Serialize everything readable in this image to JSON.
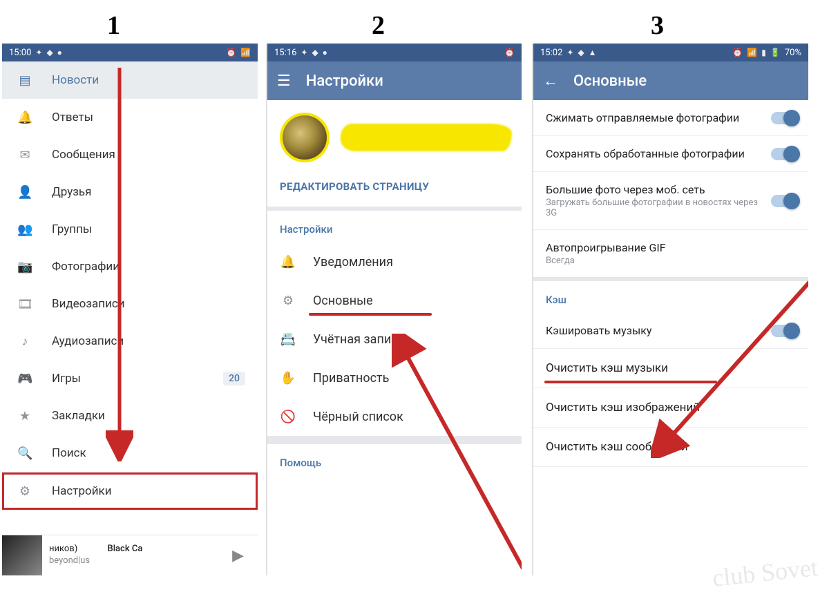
{
  "steps": {
    "s1": "1",
    "s2": "2",
    "s3": "3"
  },
  "shot1": {
    "time": "15:00",
    "menu": {
      "news": "Новости",
      "replies": "Ответы",
      "messages": "Сообщения",
      "friends": "Друзья",
      "groups": "Группы",
      "photos": "Фотографии",
      "videos": "Видеозаписи",
      "audio": "Аудиозаписи",
      "games": "Игры",
      "games_badge": "20",
      "bookmarks": "Закладки",
      "search": "Поиск",
      "settings": "Настройки"
    },
    "player": {
      "title_left": "ников)",
      "title_right": "Black Ca",
      "subtitle": "beyond|us"
    }
  },
  "shot2": {
    "time": "15:16",
    "header": "Настройки",
    "edit_profile": "РЕДАКТИРОВАТЬ СТРАНИЦУ",
    "section_settings": "Настройки",
    "items": {
      "notifications": "Уведомления",
      "general": "Основные",
      "account": "Учётная запись",
      "privacy": "Приватность",
      "blacklist": "Чёрный список"
    },
    "section_help": "Помощь"
  },
  "shot3": {
    "time": "15:02",
    "battery": "70%",
    "header": "Основные",
    "rows": {
      "compress": "Сжимать отправляемые фотографии",
      "save_processed": "Сохранять обработанные фотографии",
      "big_photos": "Большие фото через моб. сеть",
      "big_photos_sub": "Загружать большие фотографии в новостях через 3G",
      "gif": "Автопроигрывание GIF",
      "gif_sub": "Всегда"
    },
    "cache_title": "Кэш",
    "cache": {
      "cache_music": "Кэшировать музыку",
      "clear_music": "Очистить кэш музыки",
      "clear_images": "Очистить кэш изображений",
      "clear_messages": "Очистить кэш сообщений"
    }
  },
  "watermark": "club Sovet"
}
